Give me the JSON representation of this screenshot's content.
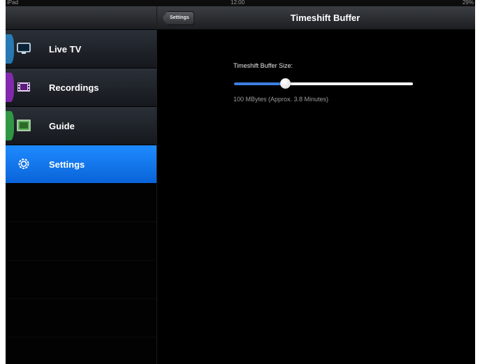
{
  "status_bar": {
    "carrier": "iPad",
    "time": "12:00",
    "battery": "29%"
  },
  "sidebar": {
    "items": [
      {
        "label": "Live TV",
        "icon": "tv-icon",
        "accent": "#2a8fd6",
        "active": false
      },
      {
        "label": "Recordings",
        "icon": "film-icon",
        "accent": "#9b2bd0",
        "active": false
      },
      {
        "label": "Guide",
        "icon": "guide-icon",
        "accent": "#35b54a",
        "active": false
      },
      {
        "label": "Settings",
        "icon": "gear-icon",
        "accent": "#1e8bff",
        "active": true
      }
    ]
  },
  "navbar": {
    "back_label": "Settings",
    "title": "Timeshift Buffer"
  },
  "timeshift": {
    "label": "Timeshift Buffer Size:",
    "value_text": "100 MBytes (Approx. 3.8 Minutes)",
    "slider_fraction": 0.29
  },
  "colors": {
    "active_item": "#1e8bff",
    "slider_fill": "#3c7fe0",
    "background": "#000000"
  }
}
